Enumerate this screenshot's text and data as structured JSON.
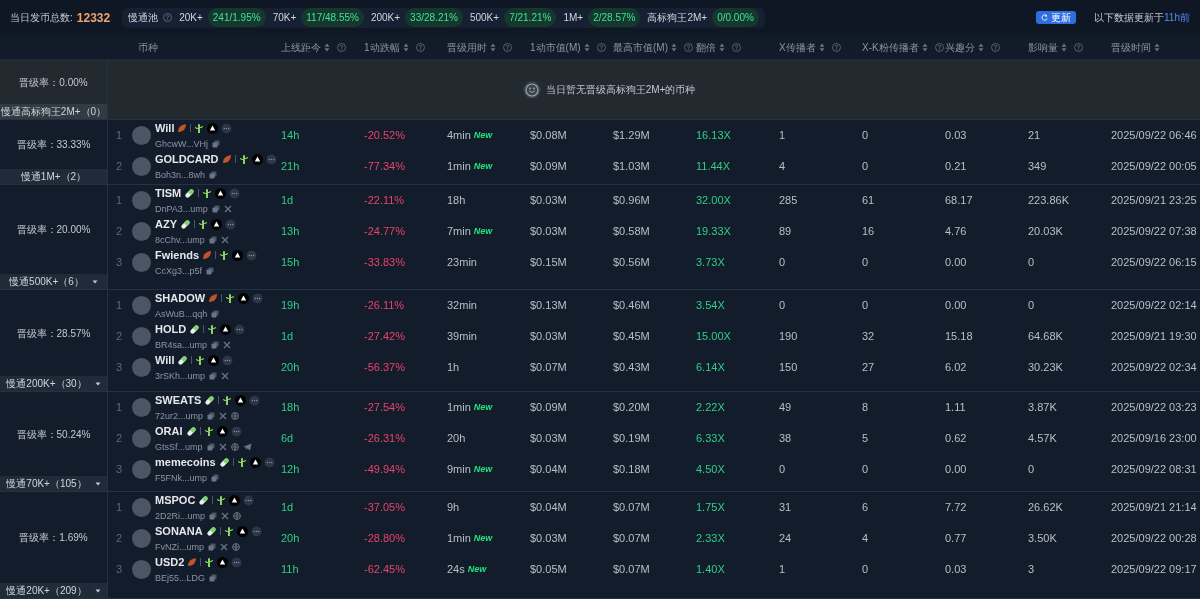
{
  "summary": {
    "label": "当日发币总数:",
    "value": "12332"
  },
  "pool": {
    "label": "慢通池",
    "chips": [
      {
        "label": "20K+",
        "value": "241/1.95%"
      },
      {
        "label": "70K+",
        "value": "117/48.55%"
      },
      {
        "label": "200K+",
        "value": "33/28.21%"
      },
      {
        "label": "500K+",
        "value": "7/21.21%"
      },
      {
        "label": "1M+",
        "value": "2/28.57%"
      },
      {
        "label": "高标狗王2M+",
        "value": "0/0.00%"
      }
    ]
  },
  "refresh_button": "更新",
  "updated": {
    "text": "以下数据更新于",
    "link": "11h前"
  },
  "table": {
    "columns": [
      {
        "label": "币种",
        "sortable": false,
        "info": false
      },
      {
        "label": "上线距今",
        "sortable": true,
        "info": true
      },
      {
        "label": "1动跌幅",
        "sortable": true,
        "info": true
      },
      {
        "label": "晋级用时",
        "sortable": true,
        "info": true
      },
      {
        "label": "1动市值(M)",
        "sortable": true,
        "info": true
      },
      {
        "label": "最高市值(M)",
        "sortable": true,
        "info": true
      },
      {
        "label": "翻倍",
        "sortable": true,
        "info": true
      },
      {
        "label": "X传播者",
        "sortable": true,
        "info": true
      },
      {
        "label": "X-K粉传播者",
        "sortable": true,
        "info": true
      },
      {
        "label": "兴趣分",
        "sortable": true,
        "info": true
      },
      {
        "label": "影响量",
        "sortable": true,
        "info": true
      },
      {
        "label": "晋级时间",
        "sortable": true,
        "info": false
      }
    ],
    "groups": [
      {
        "rate": "晋级率：0.00%",
        "label": "慢通高标狗王2M+（0）",
        "caret": false,
        "empty_message": "当日暂无晋级高标狗王2M+的币种"
      },
      {
        "rate": "晋级率：33.33%",
        "label": "慢通1M+（2）",
        "caret": false,
        "rows": [
          {
            "index": "1",
            "name": "Will",
            "kind": "flame",
            "address": "GhcwW...VHj",
            "age": "14h",
            "drop": "-20.52%",
            "time": "4min",
            "new_tag": "New",
            "mcap": "$0.08M",
            "max_mcap": "$1.29M",
            "multiple": "16.13X",
            "x_spreaders": "1",
            "xk_spreaders": "0",
            "interest": "0.03",
            "influence": "21",
            "promoted_at": "2025/09/22 06:46"
          },
          {
            "index": "2",
            "name": "GOLDCARD",
            "kind": "flame",
            "address": "Boh3n...8wh",
            "age": "21h",
            "drop": "-77.34%",
            "time": "1min",
            "new_tag": "New",
            "mcap": "$0.09M",
            "max_mcap": "$1.03M",
            "multiple": "11.44X",
            "x_spreaders": "4",
            "xk_spreaders": "0",
            "interest": "0.21",
            "influence": "349",
            "promoted_at": "2025/09/22 00:05"
          }
        ]
      },
      {
        "rate": "晋级率：20.00%",
        "label": "慢通500K+（6）",
        "caret": true,
        "rows": [
          {
            "index": "1",
            "name": "TISM",
            "kind": "pill",
            "address": "DnPA3...ump",
            "links": [
              {
                "kind": "x"
              }
            ],
            "age": "1d",
            "drop": "-22.11%",
            "time": "18h",
            "mcap": "$0.03M",
            "max_mcap": "$0.96M",
            "multiple": "32.00X",
            "x_spreaders": "285",
            "xk_spreaders": "61",
            "interest": "68.17",
            "influence": "223.86K",
            "promoted_at": "2025/09/21 23:25"
          },
          {
            "index": "2",
            "name": "AZY",
            "kind": "pill",
            "address": "8cChv...ump",
            "links": [
              {
                "kind": "x"
              }
            ],
            "age": "13h",
            "drop": "-24.77%",
            "time": "7min",
            "new_tag": "New",
            "mcap": "$0.03M",
            "max_mcap": "$0.58M",
            "multiple": "19.33X",
            "x_spreaders": "89",
            "xk_spreaders": "16",
            "interest": "4.76",
            "influence": "20.03K",
            "promoted_at": "2025/09/22 07:38"
          },
          {
            "index": "3",
            "name": "Fwiends",
            "kind": "flame",
            "address": "CcXg3...p5f",
            "age": "15h",
            "drop": "-33.83%",
            "time": "23min",
            "mcap": "$0.15M",
            "max_mcap": "$0.56M",
            "multiple": "3.73X",
            "x_spreaders": "0",
            "xk_spreaders": "0",
            "interest": "0.00",
            "influence": "0",
            "promoted_at": "2025/09/22 06:15"
          }
        ]
      },
      {
        "rate": "晋级率：28.57%",
        "label": "慢通200K+（30）",
        "caret": true,
        "rows": [
          {
            "index": "1",
            "name": "SHADOW",
            "kind": "flame",
            "address": "AsWuB...qqh",
            "age": "19h",
            "drop": "-26.11%",
            "time": "32min",
            "mcap": "$0.13M",
            "max_mcap": "$0.46M",
            "multiple": "3.54X",
            "x_spreaders": "0",
            "xk_spreaders": "0",
            "interest": "0.00",
            "influence": "0",
            "promoted_at": "2025/09/22 02:14"
          },
          {
            "index": "2",
            "name": "HOLD",
            "kind": "pill",
            "address": "BR4sa...ump",
            "links": [
              {
                "kind": "x"
              }
            ],
            "age": "1d",
            "drop": "-27.42%",
            "time": "39min",
            "mcap": "$0.03M",
            "max_mcap": "$0.45M",
            "multiple": "15.00X",
            "x_spreaders": "190",
            "xk_spreaders": "32",
            "interest": "15.18",
            "influence": "64.68K",
            "promoted_at": "2025/09/21 19:30"
          },
          {
            "index": "3",
            "name": "Will",
            "kind": "pill",
            "address": "3rSKh...ump",
            "links": [
              {
                "kind": "x"
              }
            ],
            "age": "20h",
            "drop": "-56.37%",
            "time": "1h",
            "mcap": "$0.07M",
            "max_mcap": "$0.43M",
            "multiple": "6.14X",
            "x_spreaders": "150",
            "xk_spreaders": "27",
            "interest": "6.02",
            "influence": "30.23K",
            "promoted_at": "2025/09/22 02:34"
          }
        ]
      },
      {
        "rate": "晋级率：50.24%",
        "label": "慢通70K+（105）",
        "caret": true,
        "rows": [
          {
            "index": "1",
            "name": "SWEATS",
            "kind": "pill",
            "address": "72ur2...ump",
            "links": [
              {
                "kind": "x"
              },
              {
                "kind": "web"
              }
            ],
            "age": "18h",
            "drop": "-27.54%",
            "time": "1min",
            "new_tag": "New",
            "mcap": "$0.09M",
            "max_mcap": "$0.20M",
            "multiple": "2.22X",
            "x_spreaders": "49",
            "xk_spreaders": "8",
            "interest": "1.11",
            "influence": "3.87K",
            "promoted_at": "2025/09/22 03:23"
          },
          {
            "index": "2",
            "name": "ORAI",
            "kind": "pill",
            "address": "GtsSf...ump",
            "links": [
              {
                "kind": "x"
              },
              {
                "kind": "web"
              },
              {
                "kind": "telegram"
              }
            ],
            "age": "6d",
            "drop": "-26.31%",
            "time": "20h",
            "mcap": "$0.03M",
            "max_mcap": "$0.19M",
            "multiple": "6.33X",
            "x_spreaders": "38",
            "xk_spreaders": "5",
            "interest": "0.62",
            "influence": "4.57K",
            "promoted_at": "2025/09/16 23:00"
          },
          {
            "index": "3",
            "name": "memecoins",
            "kind": "pill",
            "address": "F5FNk...ump",
            "age": "12h",
            "drop": "-49.94%",
            "time": "9min",
            "new_tag": "New",
            "mcap": "$0.04M",
            "max_mcap": "$0.18M",
            "multiple": "4.50X",
            "x_spreaders": "0",
            "xk_spreaders": "0",
            "interest": "0.00",
            "influence": "0",
            "promoted_at": "2025/09/22 08:31"
          }
        ]
      },
      {
        "rate": "晋级率：1.69%",
        "label": "慢通20K+（209）",
        "caret": true,
        "rows": [
          {
            "index": "1",
            "name": "MSPOC",
            "kind": "pill",
            "address": "2D2Ri...ump",
            "links": [
              {
                "kind": "x"
              },
              {
                "kind": "web"
              }
            ],
            "age": "1d",
            "drop": "-37.05%",
            "time": "9h",
            "mcap": "$0.04M",
            "max_mcap": "$0.07M",
            "multiple": "1.75X",
            "x_spreaders": "31",
            "xk_spreaders": "6",
            "interest": "7.72",
            "influence": "26.62K",
            "promoted_at": "2025/09/21 21:14"
          },
          {
            "index": "2",
            "name": "SONANA",
            "kind": "pill",
            "address": "FvNZi...ump",
            "links": [
              {
                "kind": "x"
              },
              {
                "kind": "web"
              }
            ],
            "age": "20h",
            "drop": "-28.80%",
            "time": "1min",
            "new_tag": "New",
            "mcap": "$0.03M",
            "max_mcap": "$0.07M",
            "multiple": "2.33X",
            "x_spreaders": "24",
            "xk_spreaders": "4",
            "interest": "0.77",
            "influence": "3.50K",
            "promoted_at": "2025/09/22 00:28"
          },
          {
            "index": "3",
            "name": "USD2",
            "kind": "flame",
            "address": "BEj55...LDG",
            "age": "11h",
            "drop": "-62.45%",
            "time": "24s",
            "new_tag": "New",
            "mcap": "$0.05M",
            "max_mcap": "$0.07M",
            "multiple": "1.40X",
            "x_spreaders": "1",
            "xk_spreaders": "0",
            "interest": "0.03",
            "influence": "3",
            "promoted_at": "2025/09/22 09:17"
          }
        ]
      }
    ]
  }
}
